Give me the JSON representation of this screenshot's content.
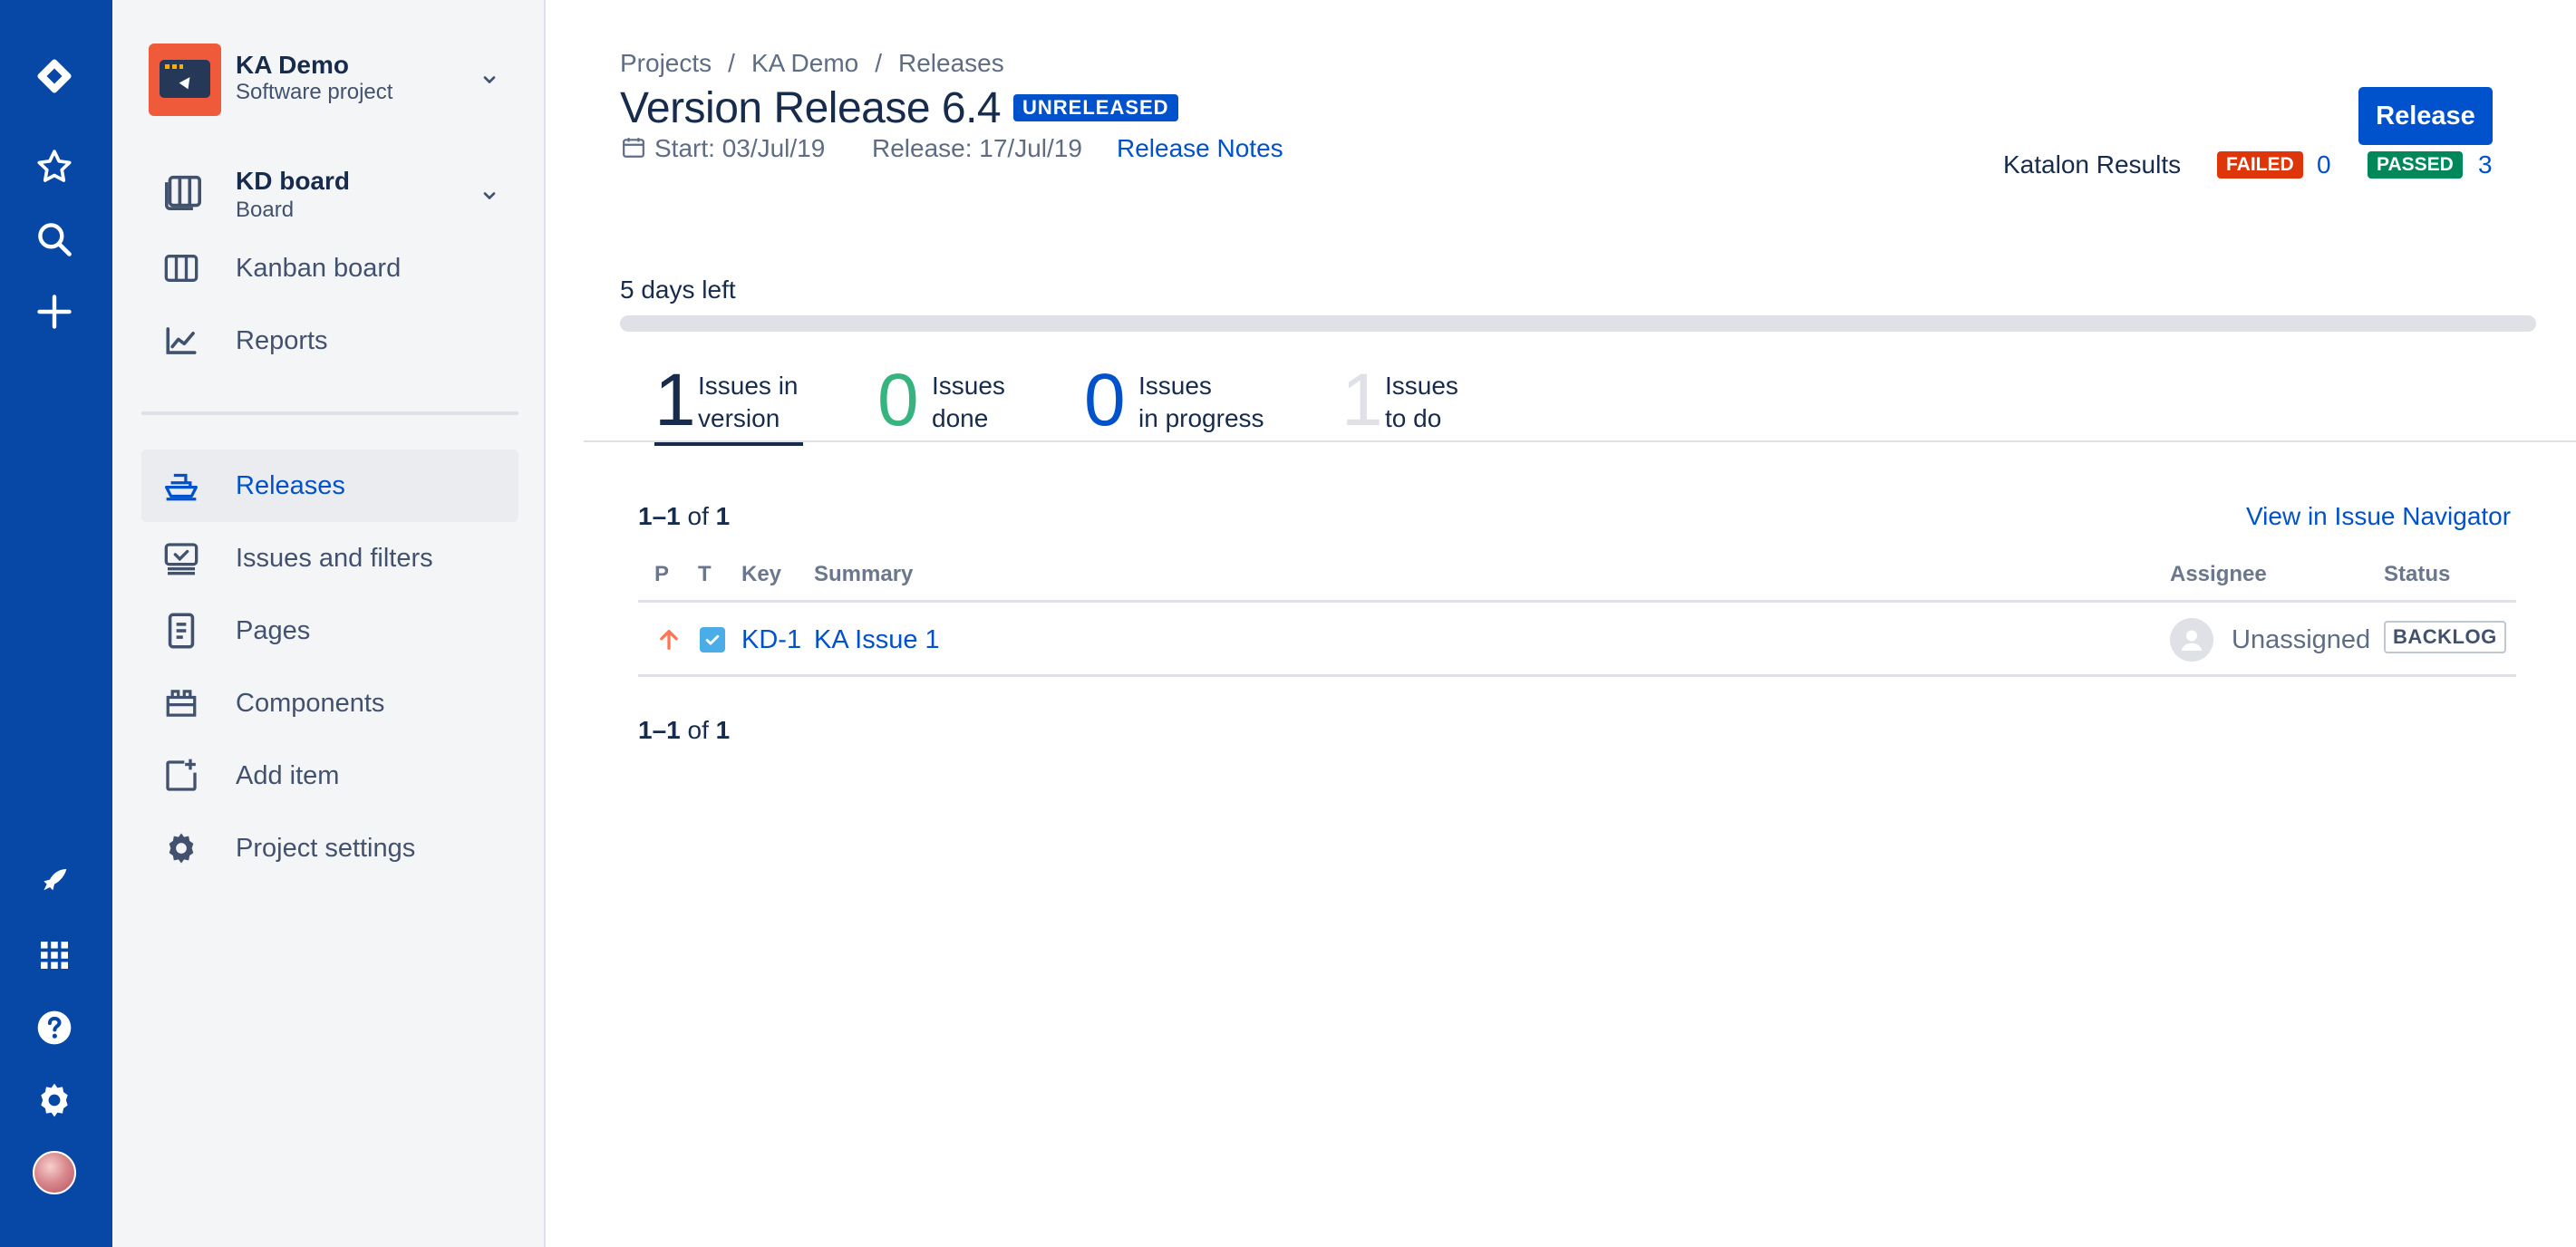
{
  "colors": {
    "global_nav": "#0747a6",
    "sidebar": "#f4f5f7",
    "accent": "#0052cc",
    "failed": "#de350b",
    "passed": "#00875a",
    "done": "#36b37e"
  },
  "global_nav": {
    "icons": [
      "jira-logo-icon",
      "star-icon",
      "search-icon",
      "plus-icon",
      "notification-icon",
      "apps-icon",
      "help-icon",
      "settings-icon",
      "user-avatar"
    ]
  },
  "sidebar": {
    "project": {
      "name": "KA Demo",
      "type": "Software project"
    },
    "board": {
      "name": "KD board",
      "type": "Board"
    },
    "top_items": [
      {
        "label": "Kanban board",
        "icon": "kanban-icon"
      },
      {
        "label": "Reports",
        "icon": "reports-icon"
      }
    ],
    "items": [
      {
        "label": "Releases",
        "icon": "ship-icon",
        "active": true
      },
      {
        "label": "Issues and filters",
        "icon": "issues-icon"
      },
      {
        "label": "Pages",
        "icon": "page-icon"
      },
      {
        "label": "Components",
        "icon": "component-icon"
      },
      {
        "label": "Add item",
        "icon": "add-item-icon"
      },
      {
        "label": "Project settings",
        "icon": "gear-icon"
      }
    ]
  },
  "breadcrumb": [
    "Projects",
    "KA Demo",
    "Releases"
  ],
  "version": {
    "title": "Version Release 6.4",
    "status": "UNRELEASED",
    "start": "Start: 03/Jul/19",
    "release": "Release: 17/Jul/19",
    "release_notes": "Release Notes",
    "release_button": "Release"
  },
  "katalon": {
    "label": "Katalon Results",
    "failed_label": "FAILED",
    "failed_count": "0",
    "passed_label": "PASSED",
    "passed_count": "3"
  },
  "progress": {
    "days_left": "5 days left",
    "done_fraction": 0
  },
  "stats": [
    {
      "num": "1",
      "line1": "Issues in",
      "line2": "version",
      "color": "#172b4d",
      "active": true
    },
    {
      "num": "0",
      "line1": "Issues",
      "line2": "done",
      "color": "#36b37e"
    },
    {
      "num": "0",
      "line1": "Issues",
      "line2": "in progress",
      "color": "#0052cc"
    },
    {
      "num": "1",
      "line1": "Issues",
      "line2": "to do",
      "color": "#dfe1e6"
    }
  ],
  "table": {
    "count_range": "1–1",
    "count_of": "of",
    "count_total": "1",
    "view_navigator": "View in Issue Navigator",
    "headers": {
      "p": "P",
      "t": "T",
      "key": "Key",
      "summary": "Summary",
      "assignee": "Assignee",
      "status": "Status"
    },
    "rows": [
      {
        "priority": "arrow-up-icon",
        "type": "task-icon",
        "key": "KD-1",
        "summary": "KA Issue 1",
        "assignee": "Unassigned",
        "status": "BACKLOG"
      }
    ]
  }
}
